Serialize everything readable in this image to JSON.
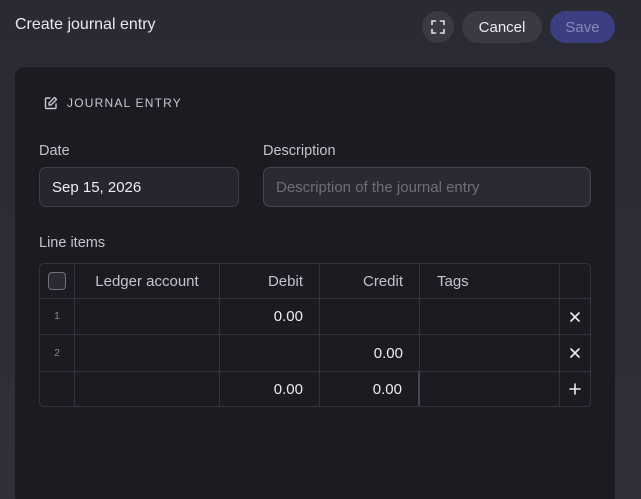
{
  "header": {
    "title": "Create journal entry",
    "cancel_label": "Cancel",
    "save_label": "Save"
  },
  "section": {
    "title": "JOURNAL ENTRY"
  },
  "form": {
    "date_label": "Date",
    "date_value": "Sep 15, 2026",
    "description_label": "Description",
    "description_placeholder": "Description of the journal entry",
    "line_items_label": "Line items"
  },
  "table": {
    "columns": [
      "Ledger account",
      "Debit",
      "Credit",
      "Tags"
    ],
    "rows": [
      {
        "num": "1",
        "ledger": "",
        "debit": "0.00",
        "credit": "",
        "tags": ""
      },
      {
        "num": "2",
        "ledger": "",
        "debit": "",
        "credit": "0.00",
        "tags": ""
      }
    ],
    "totals": {
      "debit": "0.00",
      "credit": "0.00"
    }
  },
  "icons": {
    "expand": "expand-icon",
    "edit": "edit-icon",
    "remove": "close-icon",
    "add": "plus-icon"
  },
  "colors": {
    "primary": "#3b3f82",
    "panel": "#1b1b22",
    "background": "#2b2b35"
  }
}
